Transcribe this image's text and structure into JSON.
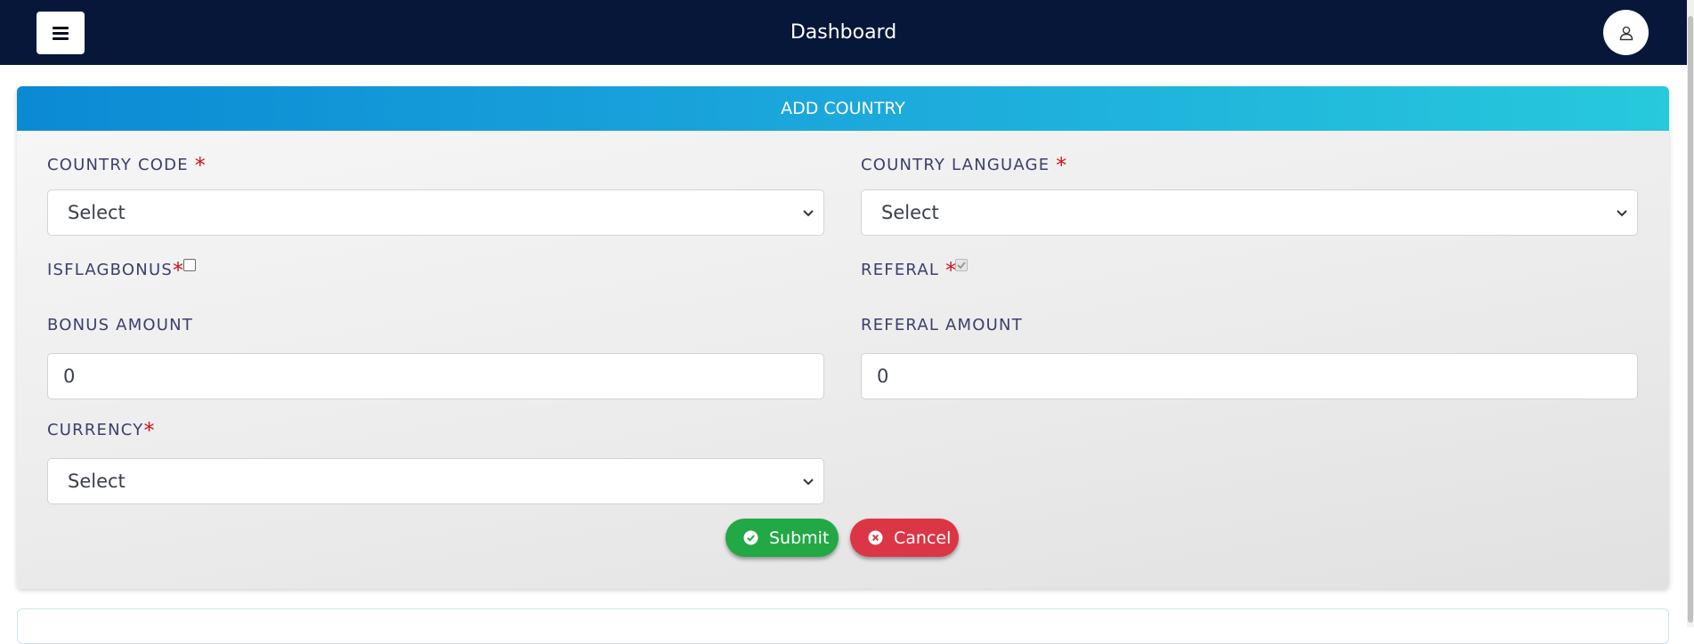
{
  "header": {
    "title": "Dashboard"
  },
  "form": {
    "title": "ADD COUNTRY",
    "required_marker": "*",
    "country_code": {
      "label": "COUNTRY CODE",
      "value": "Select"
    },
    "country_language": {
      "label": "COUNTRY LANGUAGE",
      "value": "Select"
    },
    "is_flag_bonus": {
      "label": "ISFLAGBONUS",
      "checked": false
    },
    "referal": {
      "label": "REFERAL",
      "checked": true,
      "disabled": true
    },
    "bonus_amount": {
      "label": "BONUS AMOUNT",
      "value": "0"
    },
    "referal_amount": {
      "label": "REFERAL AMOUNT",
      "value": "0"
    },
    "currency": {
      "label": "CURRENCY",
      "value": "Select"
    }
  },
  "actions": {
    "submit_label": "Submit",
    "cancel_label": "Cancel"
  },
  "colors": {
    "topbar": "#06173a",
    "header_gradient_start": "#0b8ad4",
    "header_gradient_end": "#27c9dc",
    "submit": "#22a845",
    "cancel": "#dc3545",
    "required": "#d0121b"
  }
}
